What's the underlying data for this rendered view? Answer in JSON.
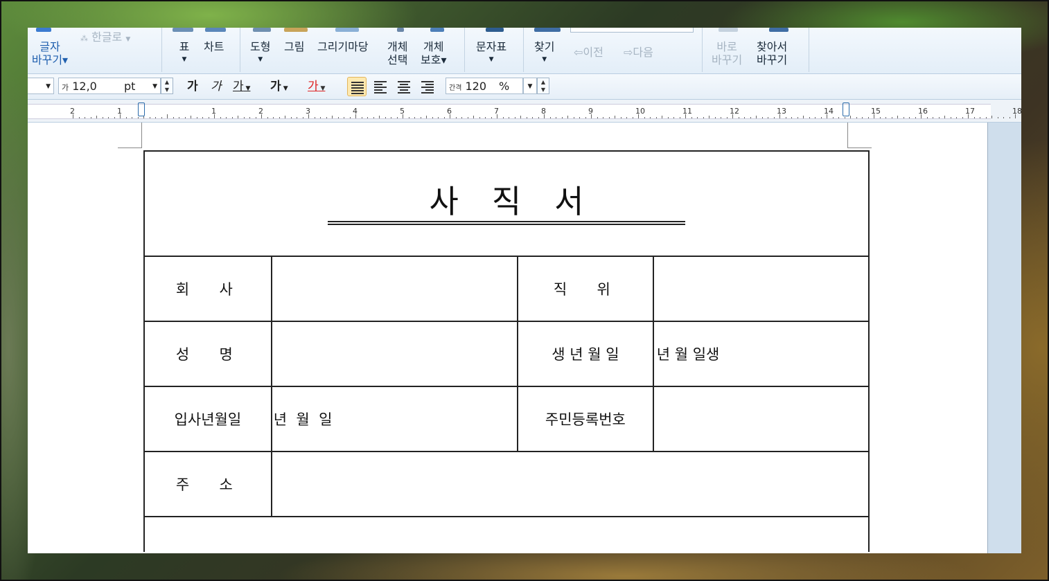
{
  "ribbon": {
    "char_replace": {
      "line1": "글자",
      "line2": "바꾸기▾"
    },
    "hanja_convert": "한글로",
    "table": "표",
    "chart": "차트",
    "shape": "도형",
    "picture": "그림",
    "drawing_gallery": "그리기마당",
    "object_select": {
      "line1": "개체",
      "line2": "선택"
    },
    "object_protect": {
      "line1": "개체",
      "line2": "보호▾"
    },
    "char_map": "문자표",
    "find": "찾기",
    "prev": "이전",
    "next": "다음",
    "replace": {
      "line1": "바로",
      "line2": "바꾸기"
    },
    "find_replace": {
      "line1": "찾아서",
      "line2": "바꾸기"
    }
  },
  "format": {
    "font_size": "12,0",
    "font_size_prefix": "가",
    "unit": "pt",
    "bold": "가",
    "italic": "가",
    "underline": "가",
    "strike": "가",
    "color": "가",
    "line_spacing_label": "간격",
    "line_spacing": "120",
    "percent": "%"
  },
  "ruler": {
    "numbers": [
      "2",
      "1",
      "",
      "1",
      "2",
      "3",
      "4",
      "5",
      "6",
      "7",
      "8",
      "9",
      "10",
      "11",
      "12",
      "13",
      "14",
      "15",
      "16",
      "17",
      "18"
    ]
  },
  "document": {
    "title": "사직서",
    "rows": [
      {
        "label1": "회  사",
        "value1": "",
        "label2": "직  위",
        "value2": ""
      },
      {
        "label1": "성  명",
        "value1": "",
        "label2": "생 년 월 일",
        "value2": "년 월 일생"
      },
      {
        "label1": "입사년월일",
        "value1": "년  월  일",
        "label2": "주민등록번호",
        "value2": ""
      },
      {
        "label1": "주  소",
        "value1": ""
      }
    ]
  },
  "colors": {
    "ribbon_bg": "#e3eef8",
    "active_align": "#fde9b0",
    "color_underline": "#d22"
  }
}
